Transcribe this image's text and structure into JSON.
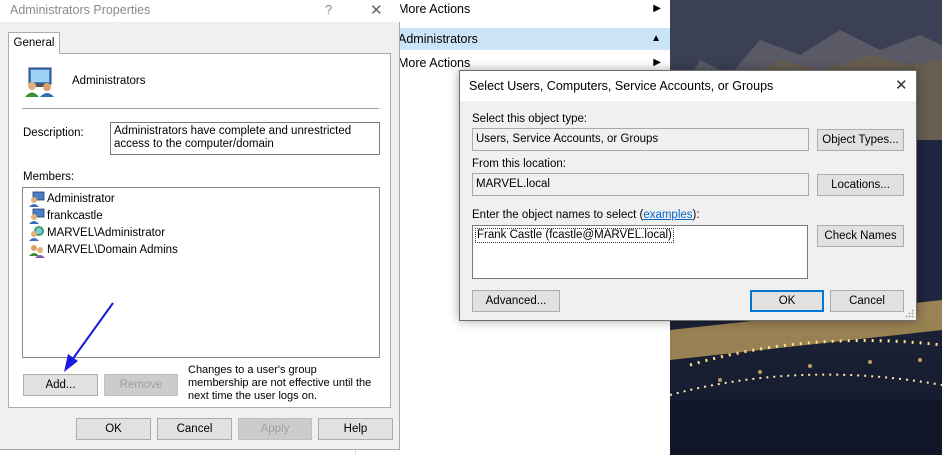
{
  "actions_pane": {
    "rows": [
      {
        "label": "More Actions",
        "arrow": "▶"
      },
      {
        "label": "Administrators",
        "arrow": "▲"
      },
      {
        "label": "More Actions",
        "arrow": "▶"
      }
    ]
  },
  "props_dialog": {
    "title": "Administrators Properties",
    "help_glyph": "?",
    "close_glyph": "✕",
    "tab_label": "General",
    "group_name": "Administrators",
    "description_label": "Description:",
    "description_value": "Administrators have complete and unrestricted access to the computer/domain",
    "members_label": "Members:",
    "members": [
      {
        "name": "Administrator",
        "icon": "user-icon"
      },
      {
        "name": "frankcastle",
        "icon": "user-icon"
      },
      {
        "name": "MARVEL\\Administrator",
        "icon": "domain-user-icon"
      },
      {
        "name": "MARVEL\\Domain Admins",
        "icon": "domain-group-icon"
      }
    ],
    "add_label": "Add...",
    "remove_label": "Remove",
    "note": "Changes to a user's group membership are not effective until the next time the user logs on.",
    "ok_label": "OK",
    "cancel_label": "Cancel",
    "apply_label": "Apply",
    "help_label": "Help"
  },
  "select_dialog": {
    "title": "Select Users, Computers, Service Accounts, or Groups",
    "close_glyph": "✕",
    "object_type_label": "Select this object type:",
    "object_type_value": "Users, Service Accounts, or Groups",
    "object_types_button": "Object Types...",
    "location_label": "From this location:",
    "location_value": "MARVEL.local",
    "locations_button": "Locations...",
    "names_label_prefix": "Enter the object names to select (",
    "names_label_link": "examples",
    "names_label_suffix": "):",
    "names_value": "Frank Castle (fcastle@MARVEL.local)",
    "check_names_button": "Check Names",
    "advanced_button": "Advanced...",
    "ok_label": "OK",
    "cancel_label": "Cancel"
  },
  "colors": {
    "selection_blue": "#cce4f7",
    "default_button_border": "#0078d7",
    "link": "#0066cc",
    "annotation_arrow": "#1a1adb"
  }
}
